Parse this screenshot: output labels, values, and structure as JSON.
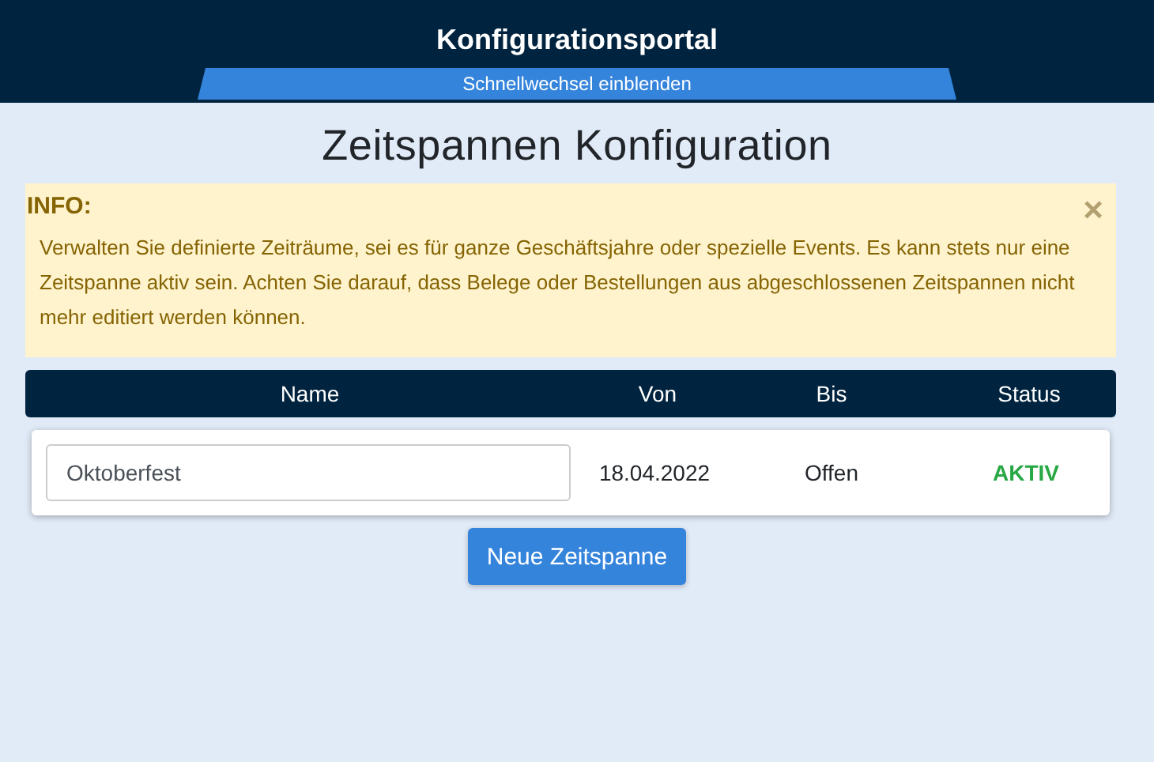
{
  "header": {
    "title": "Konfigurationsportal",
    "tab": "Schnellwechsel einblenden"
  },
  "page_title": "Zeitspannen Konfiguration",
  "info": {
    "heading": "INFO:",
    "text": "Verwalten Sie definierte Zeiträume, sei es für ganze Geschäftsjahre oder spezielle Events. Es kann stets nur eine Zeitspanne aktiv sein. Achten Sie darauf, dass Belege oder Bestellungen aus abgeschlossenen Zeitspannen nicht mehr editiert werden können.",
    "close": "×"
  },
  "table": {
    "columns": [
      "Name",
      "Von",
      "Bis",
      "Status"
    ],
    "rows": [
      {
        "name": "Oktoberfest",
        "from": "18.04.2022",
        "to": "Offen",
        "status": "AKTIV",
        "active": true
      }
    ]
  },
  "button": "Neue Zeitspanne"
}
